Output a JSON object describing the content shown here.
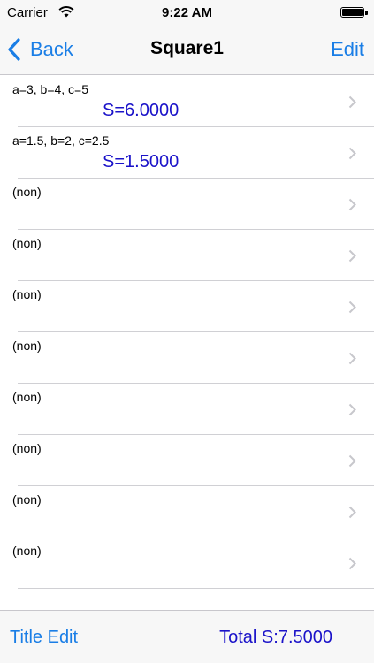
{
  "status_bar": {
    "carrier": "Carrier",
    "time": "9:22 AM",
    "battery_level": 1.0
  },
  "nav": {
    "back_label": "Back",
    "title": "Square1",
    "edit_label": "Edit"
  },
  "rows": [
    {
      "params": "a=3, b=4, c=5",
      "result": "S=6.0000"
    },
    {
      "params": "a=1.5, b=2, c=2.5",
      "result": "S=1.5000"
    },
    {
      "params": "(non)",
      "result": ""
    },
    {
      "params": "(non)",
      "result": ""
    },
    {
      "params": "(non)",
      "result": ""
    },
    {
      "params": "(non)",
      "result": ""
    },
    {
      "params": "(non)",
      "result": ""
    },
    {
      "params": "(non)",
      "result": ""
    },
    {
      "params": "(non)",
      "result": ""
    },
    {
      "params": "(non)",
      "result": ""
    }
  ],
  "toolbar": {
    "title_edit_label": "Title Edit",
    "total": "Total S:7.5000"
  },
  "colors": {
    "accent": "#1a7ee6",
    "result_text": "#1a12c9",
    "bar_background": "#f7f7f7"
  }
}
